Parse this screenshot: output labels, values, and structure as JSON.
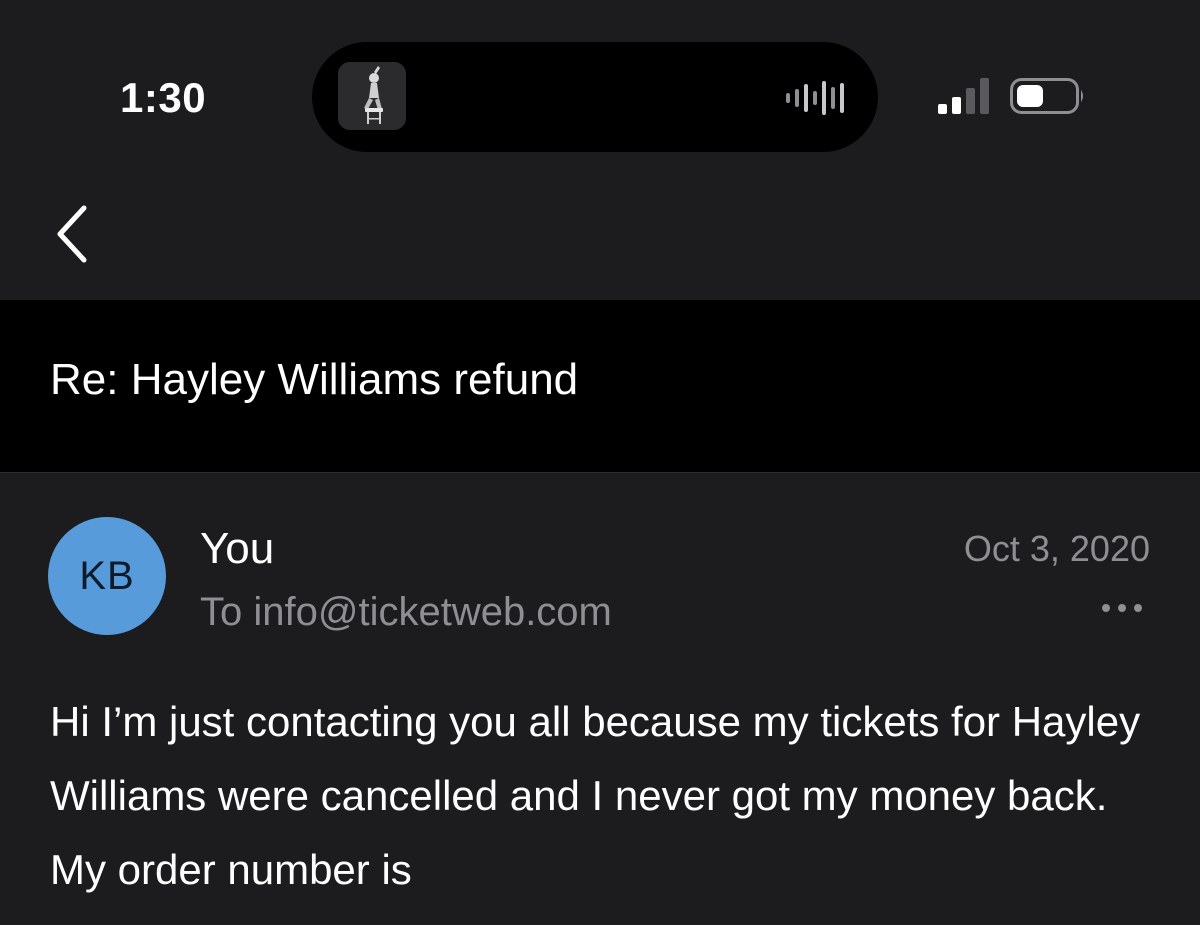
{
  "status_bar": {
    "time": "1:30",
    "icons": {
      "live_activity_art": "album-art-icon",
      "audio": "waveform-icon",
      "signal": "cellular-signal-icon",
      "battery": "battery-icon"
    }
  },
  "nav": {
    "back_icon": "chevron-left-icon"
  },
  "email": {
    "subject": "Re: Hayley Williams refund",
    "avatar_initials": "KB",
    "sender": "You",
    "recipient": "To info@ticketweb.com",
    "date": "Oct 3, 2020",
    "more_icon": "ellipsis-icon",
    "body": "Hi I’m just contacting you all because my tickets for Hayley Williams were cancelled and I never got my money back. My order number is"
  },
  "colors": {
    "background": "#1c1c1e",
    "subject_bar": "#000000",
    "avatar": "#579bdb",
    "secondary_text": "#8e8e93",
    "primary_text": "#ffffff"
  }
}
